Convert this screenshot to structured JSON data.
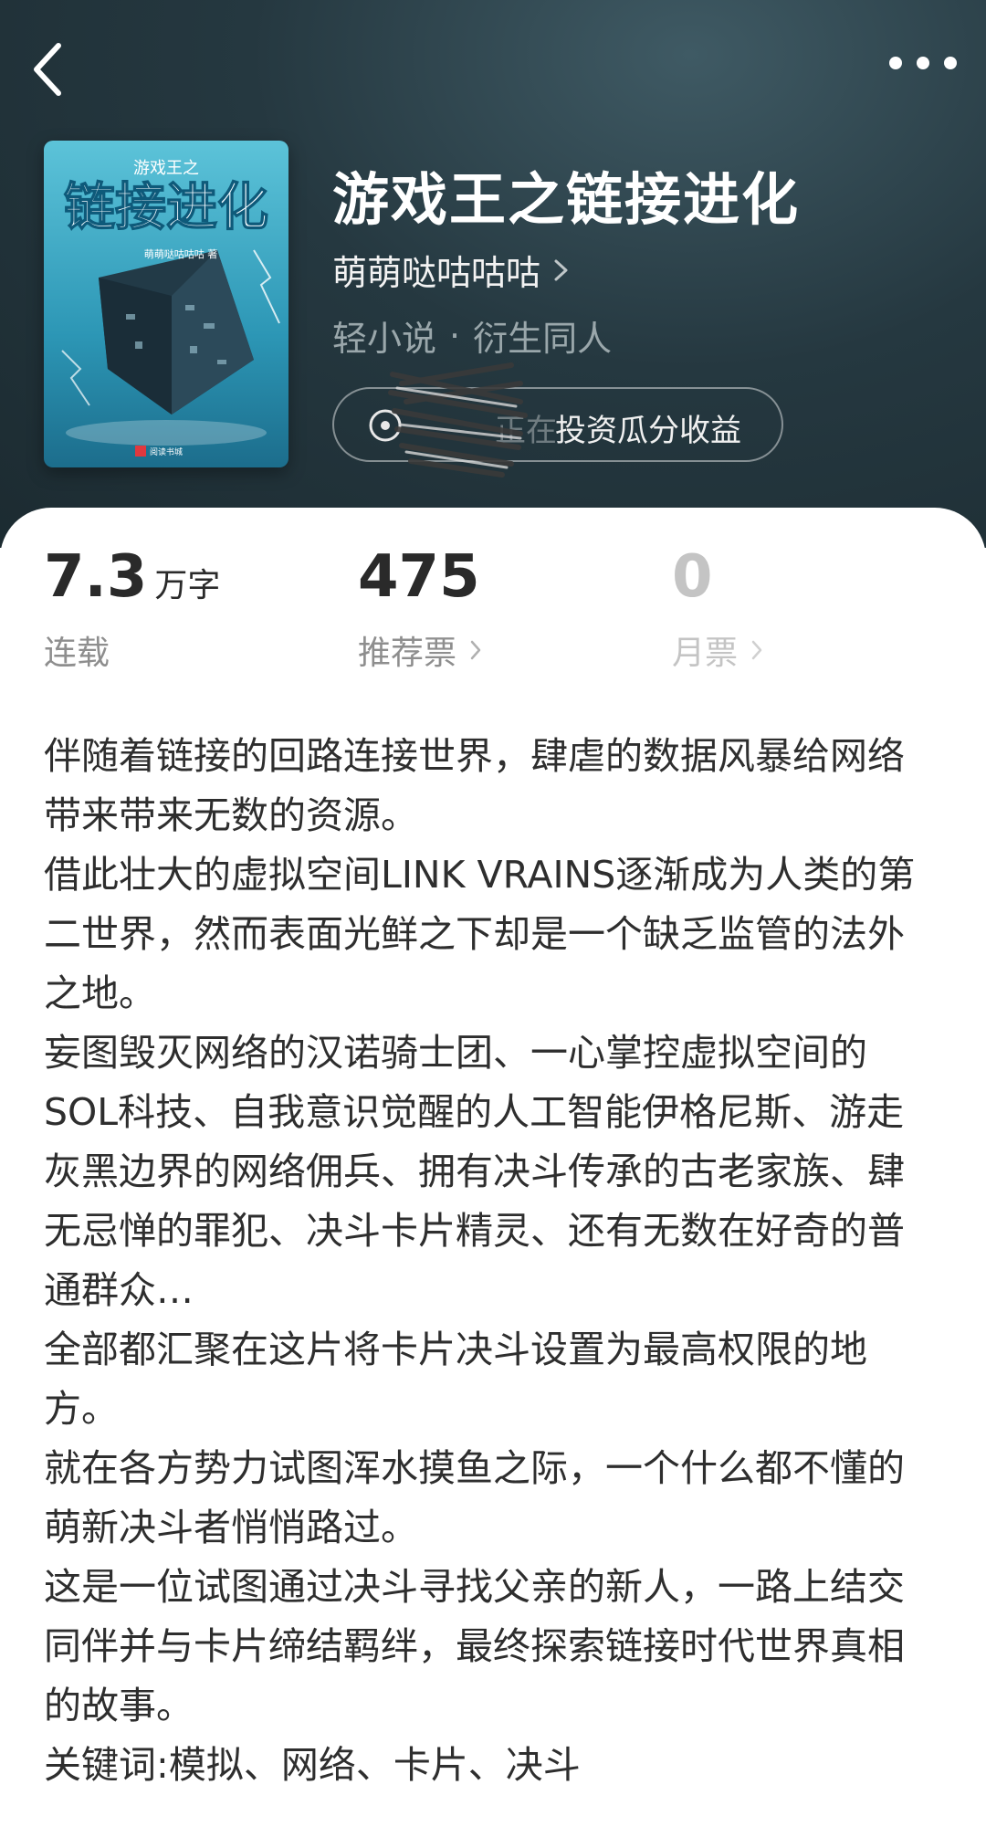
{
  "header": {
    "back_icon": "chevron-left-icon",
    "more_icon": "more-dots-icon"
  },
  "book": {
    "title": "游戏王之链接进化",
    "author": "萌萌哒咕咕咕",
    "genre": "轻小说",
    "subgenre": "衍生同人",
    "genre_separator": "·",
    "cover": {
      "small_title": "游戏王之",
      "big_title": "链接进化",
      "author_line": "萌萌哒咕咕咕 著",
      "publisher": "阅读书城"
    },
    "invest": {
      "prefix": "正在",
      "label": "投资瓜分收益"
    }
  },
  "stats": {
    "words": {
      "value": "7.3",
      "unit": "万字",
      "label": "连载"
    },
    "recommend": {
      "value": "475",
      "label": "推荐票"
    },
    "monthly": {
      "value": "0",
      "label": "月票"
    }
  },
  "description": [
    "伴随着链接的回路连接世界，肆虐的数据风暴给网络带来带来无数的资源。",
    "借此壮大的虚拟空间LINK VRAINS逐渐成为人类的第二世界，然而表面光鲜之下却是一个缺乏监管的法外之地。",
    "妄图毁灭网络的汉诺骑士团、一心掌控虚拟空间的SOL科技、自我意识觉醒的人工智能伊格尼斯、游走灰黑边界的网络佣兵、拥有决斗传承的古老家族、肆无忌惮的罪犯、决斗卡片精灵、还有无数在好奇的普通群众…",
    "全部都汇聚在这片将卡片决斗设置为最高权限的地方。",
    "就在各方势力试图浑水摸鱼之际，一个什么都不懂的萌新决斗者悄悄路过。",
    "这是一位试图通过决斗寻找父亲的新人，一路上结交同伴并与卡片缔结羁绊，最终探索链接时代世界真相的故事。",
    "关键词:模拟、网络、卡片、决斗"
  ]
}
